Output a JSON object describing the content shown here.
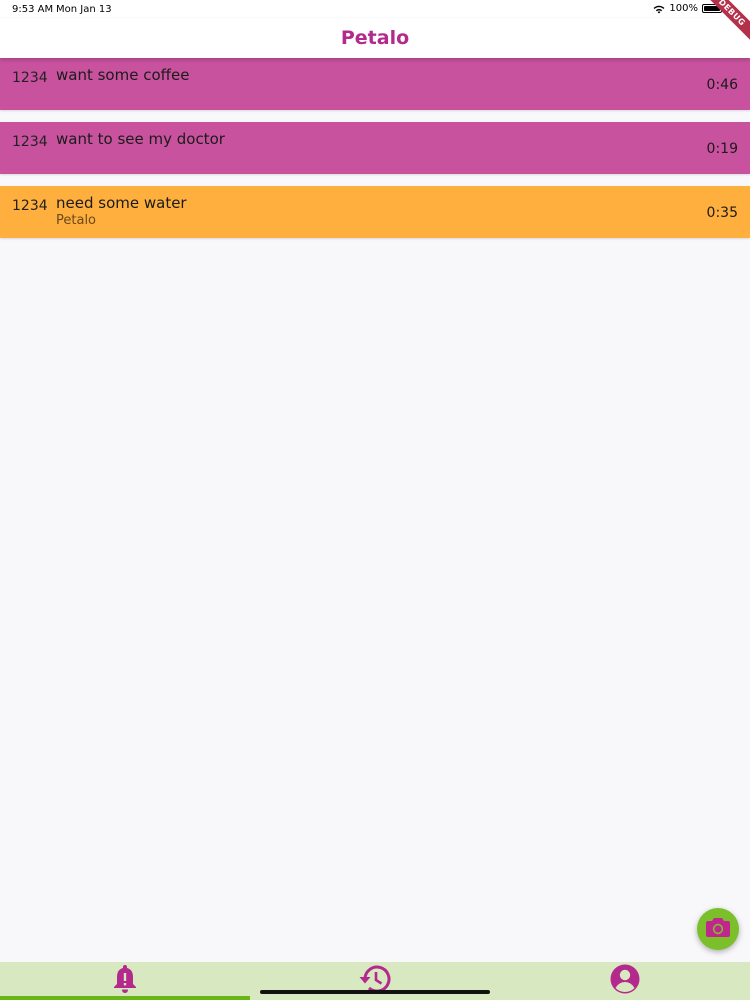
{
  "status_bar": {
    "time": "9:53 AM",
    "date": "Mon Jan 13",
    "battery": "100%",
    "debug_label": "DEBUG"
  },
  "app_bar": {
    "title": "Petalo"
  },
  "requests": [
    {
      "room": "1234",
      "message": "want some coffee",
      "sub": "",
      "timer": "0:46",
      "color": "#c8529e"
    },
    {
      "room": "1234",
      "message": "want to see my doctor",
      "sub": "",
      "timer": "0:19",
      "color": "#c8529e"
    },
    {
      "room": "1234",
      "message": "need some water",
      "sub": "Petalo",
      "timer": "0:35",
      "color": "#ffaf3d"
    }
  ],
  "fab": {
    "icon": "camera-icon"
  },
  "bottom_nav": {
    "items": [
      {
        "icon": "bell-alert-icon",
        "selected": true
      },
      {
        "icon": "history-icon",
        "selected": false
      },
      {
        "icon": "account-circle-icon",
        "selected": false
      }
    ]
  },
  "colors": {
    "brand": "#b3298c",
    "pink_row": "#c8529e",
    "orange_row": "#ffaf3d",
    "nav_background": "#d8e8c0",
    "nav_indicator": "#6ab617",
    "fab_background": "#7bbf2a"
  }
}
